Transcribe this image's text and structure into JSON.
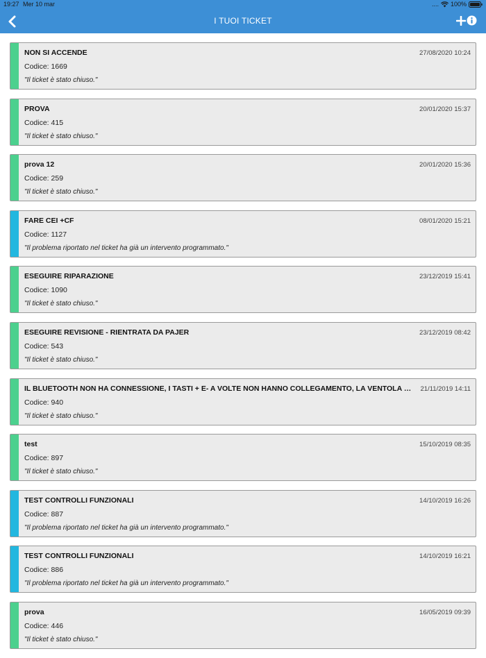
{
  "status_bar": {
    "time": "19:27",
    "date": "Mer 10 mar",
    "signal": "....",
    "battery": "100%"
  },
  "nav": {
    "title": "I TUOI TICKET"
  },
  "colors": {
    "closed": "#4cd08e",
    "scheduled": "#22b7df",
    "header": "#3d8fd6"
  },
  "tickets": [
    {
      "title": "NON SI ACCENDE",
      "date": "27/08/2020 10:24",
      "code": "Codice: 1669",
      "status": "\"Il ticket è stato chiuso.\"",
      "state": "closed"
    },
    {
      "title": "PROVA",
      "date": "20/01/2020 15:37",
      "code": "Codice: 415",
      "status": "\"Il ticket è stato chiuso.\"",
      "state": "closed"
    },
    {
      "title": "prova 12",
      "date": "20/01/2020 15:36",
      "code": "Codice: 259",
      "status": "\"Il ticket è stato chiuso.\"",
      "state": "closed"
    },
    {
      "title": "FARE CEI +CF",
      "date": "08/01/2020 15:21",
      "code": "Codice: 1127",
      "status": "\"Il problema riportato nel ticket ha già un intervento programmato.\"",
      "state": "scheduled"
    },
    {
      "title": "ESEGUIRE RIPARAZIONE",
      "date": "23/12/2019 15:41",
      "code": "Codice: 1090",
      "status": "\"Il ticket è stato chiuso.\"",
      "state": "closed"
    },
    {
      "title": "ESEGUIRE REVISIONE - RIENTRATA DA PAJER",
      "date": "23/12/2019 08:42",
      "code": "Codice: 543",
      "status": "\"Il ticket è stato chiuso.\"",
      "state": "closed"
    },
    {
      "title": "IL BLUETOOTH NON HA CONNESSIONE, I TASTI + E- A VOLTE NON HANNO COLLEGAMENTO, LA VENTOLA QUA...",
      "date": "21/11/2019 14:11",
      "code": "Codice: 940",
      "status": "\"Il ticket è stato chiuso.\"",
      "state": "closed"
    },
    {
      "title": "test",
      "date": "15/10/2019 08:35",
      "code": "Codice: 897",
      "status": "\"Il ticket è stato chiuso.\"",
      "state": "closed"
    },
    {
      "title": "TEST CONTROLLI FUNZIONALI",
      "date": "14/10/2019 16:26",
      "code": "Codice: 887",
      "status": "\"Il problema riportato nel ticket ha già un intervento programmato.\"",
      "state": "scheduled"
    },
    {
      "title": "TEST CONTROLLI FUNZIONALI",
      "date": "14/10/2019 16:21",
      "code": "Codice: 886",
      "status": "\"Il problema riportato nel ticket ha già un intervento programmato.\"",
      "state": "scheduled"
    },
    {
      "title": "prova",
      "date": "16/05/2019 09:39",
      "code": "Codice: 446",
      "status": "\"Il ticket è stato chiuso.\"",
      "state": "closed"
    }
  ]
}
